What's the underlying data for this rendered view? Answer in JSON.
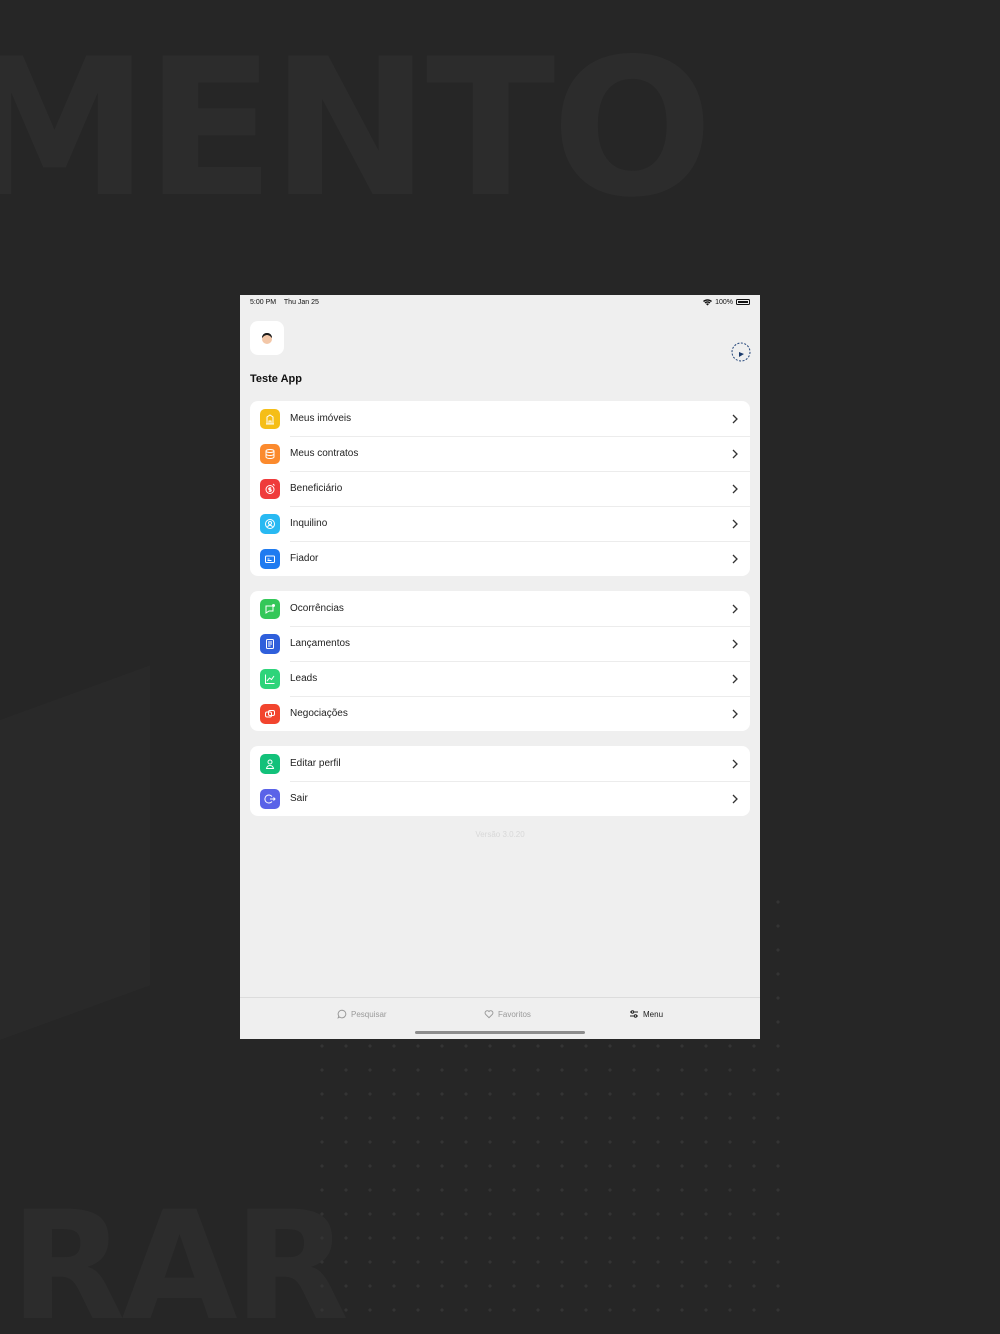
{
  "background": {
    "top_text": "MENTO",
    "bottom_text": "RAR"
  },
  "status_bar": {
    "time": "5:00 PM",
    "date": "Thu Jan 25",
    "battery": "100%"
  },
  "profile": {
    "name": "Teste App"
  },
  "colors": {
    "yellow": "#F5BE17",
    "orange": "#FB8A2D",
    "red": "#EF3B3B",
    "cyan": "#28B9F2",
    "blue": "#1F7BF0",
    "green": "#34C759",
    "indigo": "#2F5FDB",
    "mint": "#2ED47A",
    "coral": "#F2452E",
    "teal": "#13C17A",
    "violet": "#5A63E8"
  },
  "menu_groups": [
    {
      "items": [
        {
          "label": "Meus imóveis",
          "icon": "building-icon",
          "color": "#F5BE17"
        },
        {
          "label": "Meus contratos",
          "icon": "database-icon",
          "color": "#FB8A2D"
        },
        {
          "label": "Beneficiário",
          "icon": "money-icon",
          "color": "#EF3B3B"
        },
        {
          "label": "Inquilino",
          "icon": "contact-icon",
          "color": "#28B9F2"
        },
        {
          "label": "Fiador",
          "icon": "card-icon",
          "color": "#1F7BF0"
        }
      ]
    },
    {
      "items": [
        {
          "label": "Ocorrências",
          "icon": "chat-icon",
          "color": "#34C759"
        },
        {
          "label": "Lançamentos",
          "icon": "document-icon",
          "color": "#2F5FDB"
        },
        {
          "label": "Leads",
          "icon": "chart-icon",
          "color": "#2ED47A"
        },
        {
          "label": "Negociações",
          "icon": "handshake-icon",
          "color": "#F2452E"
        }
      ]
    },
    {
      "items": [
        {
          "label": "Editar perfil",
          "icon": "user-icon",
          "color": "#13C17A"
        },
        {
          "label": "Sair",
          "icon": "logout-icon",
          "color": "#5A63E8"
        }
      ]
    }
  ],
  "version": "Versão 3.0.20",
  "tabs": [
    {
      "label": "Pesquisar",
      "icon": "search-chat-icon"
    },
    {
      "label": "Favoritos",
      "icon": "heart-icon"
    },
    {
      "label": "Menu",
      "icon": "sliders-icon"
    }
  ]
}
